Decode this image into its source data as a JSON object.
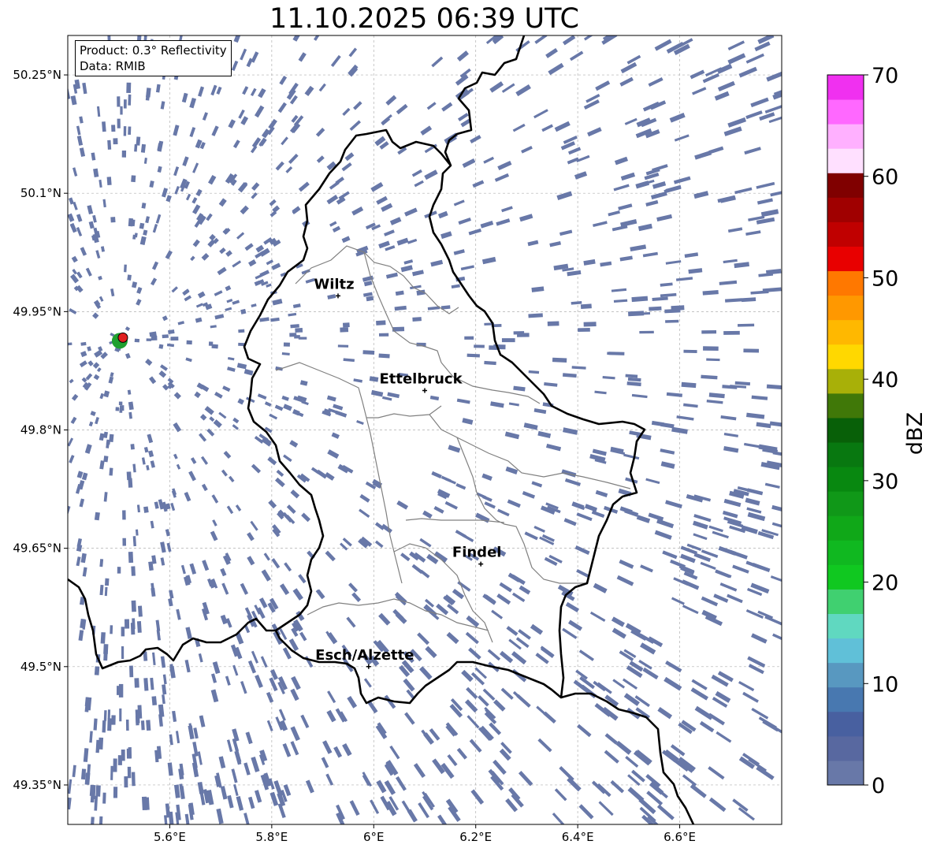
{
  "title": "11.10.2025 06:39 UTC",
  "info": {
    "product_line": "Product: 0.3° Reflectivity",
    "data_line": "Data: RMIB"
  },
  "map": {
    "lon_range": [
      5.4,
      6.8
    ],
    "lat_range": [
      49.3,
      50.3
    ],
    "lat_ticks": [
      {
        "value": 50.25,
        "label": "50.25°N"
      },
      {
        "value": 50.1,
        "label": "50.1°N"
      },
      {
        "value": 49.95,
        "label": "49.95°N"
      },
      {
        "value": 49.8,
        "label": "49.8°N"
      },
      {
        "value": 49.65,
        "label": "49.65°N"
      },
      {
        "value": 49.5,
        "label": "49.5°N"
      },
      {
        "value": 49.35,
        "label": "49.35°N"
      }
    ],
    "lon_ticks": [
      {
        "value": 5.6,
        "label": "5.6°E"
      },
      {
        "value": 5.8,
        "label": "5.8°E"
      },
      {
        "value": 6.0,
        "label": "6°E"
      },
      {
        "value": 6.2,
        "label": "6.2°E"
      },
      {
        "value": 6.4,
        "label": "6.4°E"
      },
      {
        "value": 6.6,
        "label": "6.6°E"
      }
    ],
    "cities": [
      {
        "name": "Wiltz",
        "lon": 5.93,
        "lat": 49.97
      },
      {
        "name": "Ettelbruck",
        "lon": 6.1,
        "lat": 49.85
      },
      {
        "name": "Findel",
        "lon": 6.21,
        "lat": 49.63
      },
      {
        "name": "Esch/Alzette",
        "lon": 5.99,
        "lat": 49.5
      }
    ],
    "radar_site": {
      "lon": 5.505,
      "lat": 49.915
    },
    "echo_color": "#6878a8"
  },
  "colorbar": {
    "label": "dBZ",
    "min": 0,
    "max": 70,
    "ticks": [
      0,
      10,
      20,
      30,
      40,
      50,
      60,
      70
    ],
    "colors": [
      "#6878a8",
      "#5868a0",
      "#4860a0",
      "#4878b0",
      "#5898c0",
      "#60c0d8",
      "#60d8c0",
      "#40d070",
      "#10c820",
      "#10b820",
      "#10a818",
      "#109818",
      "#088810",
      "#087810",
      "#086008",
      "#407808",
      "#a8b008",
      "#ffd800",
      "#ffb800",
      "#ff9800",
      "#ff7800",
      "#e80000",
      "#c00000",
      "#a00000",
      "#800000",
      "#ffe0ff",
      "#ffb0ff",
      "#ff68ff",
      "#f030f0"
    ]
  }
}
